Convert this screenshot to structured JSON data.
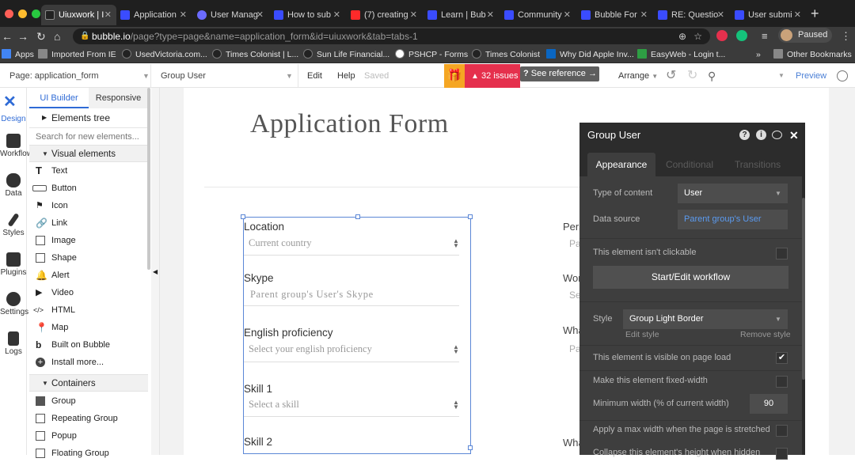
{
  "browser": {
    "tabs": [
      {
        "label": "Uiuxwork | I",
        "active": true
      },
      {
        "label": "Application"
      },
      {
        "label": "User Manag"
      },
      {
        "label": "How to sub"
      },
      {
        "label": "(7) creating"
      },
      {
        "label": "Learn | Bub"
      },
      {
        "label": "Community"
      },
      {
        "label": "Bubble For"
      },
      {
        "label": "RE: Questio"
      },
      {
        "label": "User submi"
      }
    ],
    "url_host": "bubble.io",
    "url_path": "/page?type=page&name=application_form&id=uiuxwork&tab=tabs-1",
    "profile_status": "Paused",
    "bookmarks": [
      "Apps",
      "Imported From IE",
      "UsedVictoria.com...",
      "Times Colonist | L...",
      "Sun Life Financial...",
      "PSHCP - Forms",
      "Times Colonist",
      "Why Did Apple Inv...",
      "EasyWeb - Login t..."
    ],
    "bookmarks_more": "»",
    "other_bookmarks": "Other Bookmarks"
  },
  "toolbar": {
    "page_select": "Page: application_form",
    "element_select": "Group User",
    "edit": "Edit",
    "help": "Help",
    "saved": "Saved",
    "issues": "32 issues",
    "see_reference": "See reference →",
    "arrange": "Arrange",
    "preview": "Preview"
  },
  "rail": {
    "items": [
      "Design",
      "Workflow",
      "Data",
      "Styles",
      "Plugins",
      "Settings",
      "Logs"
    ]
  },
  "palette": {
    "tabs": [
      "UI Builder",
      "Responsive"
    ],
    "elements_tree": "Elements tree",
    "search_placeholder": "Search for new elements...",
    "visual_elements_header": "Visual elements",
    "visual_elements": [
      "Text",
      "Button",
      "Icon",
      "Link",
      "Image",
      "Shape",
      "Alert",
      "Video",
      "HTML",
      "Map",
      "Built on Bubble",
      "Install more..."
    ],
    "containers_header": "Containers",
    "containers": [
      "Group",
      "Repeating Group",
      "Popup",
      "Floating Group"
    ]
  },
  "canvas": {
    "title": "Application Form",
    "fields": [
      {
        "label": "Location",
        "value": "Current country",
        "dropdown": true
      },
      {
        "label": "Skype",
        "value": "Parent group's User's Skype",
        "dropdown": false
      },
      {
        "label": "English proficiency",
        "value": "Select your english proficiency",
        "dropdown": true
      },
      {
        "label": "Skill 1",
        "value": "Select a skill",
        "dropdown": true
      },
      {
        "label": "Skill 2",
        "value": "",
        "dropdown": false
      }
    ],
    "right_fields": [
      {
        "label": "Pers",
        "value": "Pa"
      },
      {
        "label": "Wor",
        "value": "Se"
      },
      {
        "label": "Wha",
        "value": "Pa"
      },
      {
        "label": "Wha",
        "value": ""
      }
    ]
  },
  "property_editor": {
    "title": "Group User",
    "tabs": [
      "Appearance",
      "Conditional",
      "Transitions"
    ],
    "type_of_content_label": "Type of content",
    "type_of_content_value": "User",
    "data_source_label": "Data source",
    "data_source_value": "Parent group's User",
    "not_clickable_label": "This element isn't clickable",
    "workflow_button": "Start/Edit workflow",
    "style_label": "Style",
    "style_value": "Group Light Border",
    "edit_style": "Edit style",
    "remove_style": "Remove style",
    "visible_on_load_label": "This element is visible on page load",
    "visible_on_load_checked": true,
    "fixed_width_label": "Make this element fixed-width",
    "min_width_label": "Minimum width (% of current width)",
    "min_width_value": "90",
    "max_width_label": "Apply a max width when the page is stretched",
    "collapse_label": "Collapse this element's height when hidden"
  },
  "colors": {
    "issues_red": "#e5304d",
    "gift_orange": "#f5a623",
    "selection_blue": "#5b87d6",
    "link_blue": "#5b9bf0",
    "panel_dark": "#3e3e3e"
  }
}
